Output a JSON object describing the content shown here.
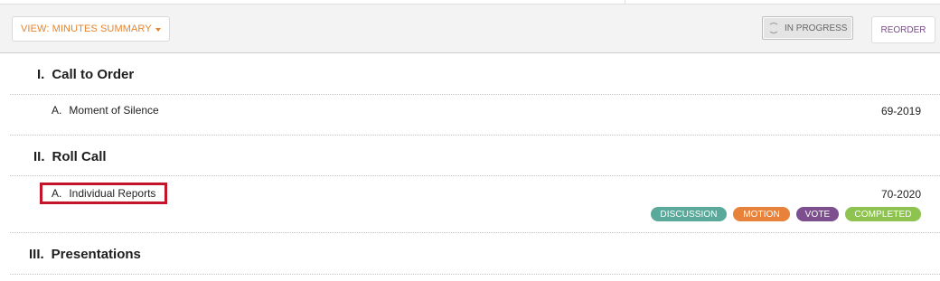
{
  "toolbar": {
    "view_label": "VIEW: MINUTES SUMMARY",
    "status_label": "IN PROGRESS",
    "reorder_label": "REORDER"
  },
  "sections": [
    {
      "numeral": "I.",
      "title": "Call to Order",
      "items": [
        {
          "letter": "A.",
          "title": "Moment of Silence",
          "number": "69-2019"
        }
      ]
    },
    {
      "numeral": "II.",
      "title": "Roll Call",
      "items": [
        {
          "letter": "A.",
          "title": "Individual Reports",
          "number": "70-2020",
          "tags": [
            "DISCUSSION",
            "MOTION",
            "VOTE",
            "COMPLETED"
          ]
        }
      ]
    },
    {
      "numeral": "III.",
      "title": "Presentations",
      "items": []
    }
  ],
  "colors": {
    "accent_orange": "#e8832a",
    "accent_purple": "#7a4b8a",
    "highlight_red": "#c4142a",
    "tag_discussion": "#5aa99b",
    "tag_motion": "#e8813a",
    "tag_vote": "#7d4f8f",
    "tag_completed": "#8ec34f"
  }
}
